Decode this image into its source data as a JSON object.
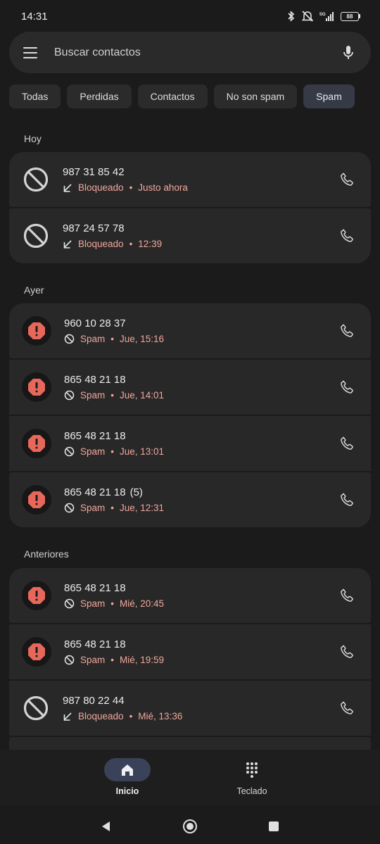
{
  "status": {
    "time": "14:31",
    "battery": "88",
    "network": "5G"
  },
  "search": {
    "placeholder": "Buscar contactos",
    "menu_icon": "menu-icon",
    "mic_icon": "mic-icon"
  },
  "filters": [
    {
      "label": "Todas",
      "active": false
    },
    {
      "label": "Perdidas",
      "active": false
    },
    {
      "label": "Contactos",
      "active": false
    },
    {
      "label": "No son spam",
      "active": false
    },
    {
      "label": "Spam",
      "active": true
    }
  ],
  "sections": {
    "today": {
      "title": "Hoy",
      "calls": [
        {
          "number": "987 31 85 42",
          "status": "Bloqueado",
          "time": "Justo ahora",
          "type": "blocked"
        },
        {
          "number": "987 24 57 78",
          "status": "Bloqueado",
          "time": "12:39",
          "type": "blocked"
        }
      ]
    },
    "yesterday": {
      "title": "Ayer",
      "calls": [
        {
          "number": "960 10 28 37",
          "status": "Spam",
          "time": "Jue, 15:16",
          "type": "spam"
        },
        {
          "number": "865 48 21 18",
          "status": "Spam",
          "time": "Jue, 14:01",
          "type": "spam"
        },
        {
          "number": "865 48 21 18",
          "status": "Spam",
          "time": "Jue, 13:01",
          "type": "spam"
        },
        {
          "number": "865 48 21 18",
          "count": "(5)",
          "status": "Spam",
          "time": "Jue, 12:31",
          "type": "spam"
        }
      ]
    },
    "older": {
      "title": "Anteriores",
      "calls": [
        {
          "number": "865 48 21 18",
          "status": "Spam",
          "time": "Mié, 20:45",
          "type": "spam"
        },
        {
          "number": "865 48 21 18",
          "status": "Spam",
          "time": "Mié, 19:59",
          "type": "spam"
        },
        {
          "number": "987 80 22 44",
          "status": "Bloqueado",
          "time": "Mié, 13:36",
          "type": "blocked"
        }
      ]
    }
  },
  "separator": "•",
  "bottom_nav": {
    "home": {
      "label": "Inicio",
      "icon": "home-icon",
      "active": true
    },
    "keypad": {
      "label": "Teclado",
      "icon": "dialpad-icon",
      "active": false
    }
  },
  "colors": {
    "accent_spam": "#e8675b",
    "sub_text": "#f0a79c",
    "card": "#282828",
    "background": "#1b1b1b"
  }
}
